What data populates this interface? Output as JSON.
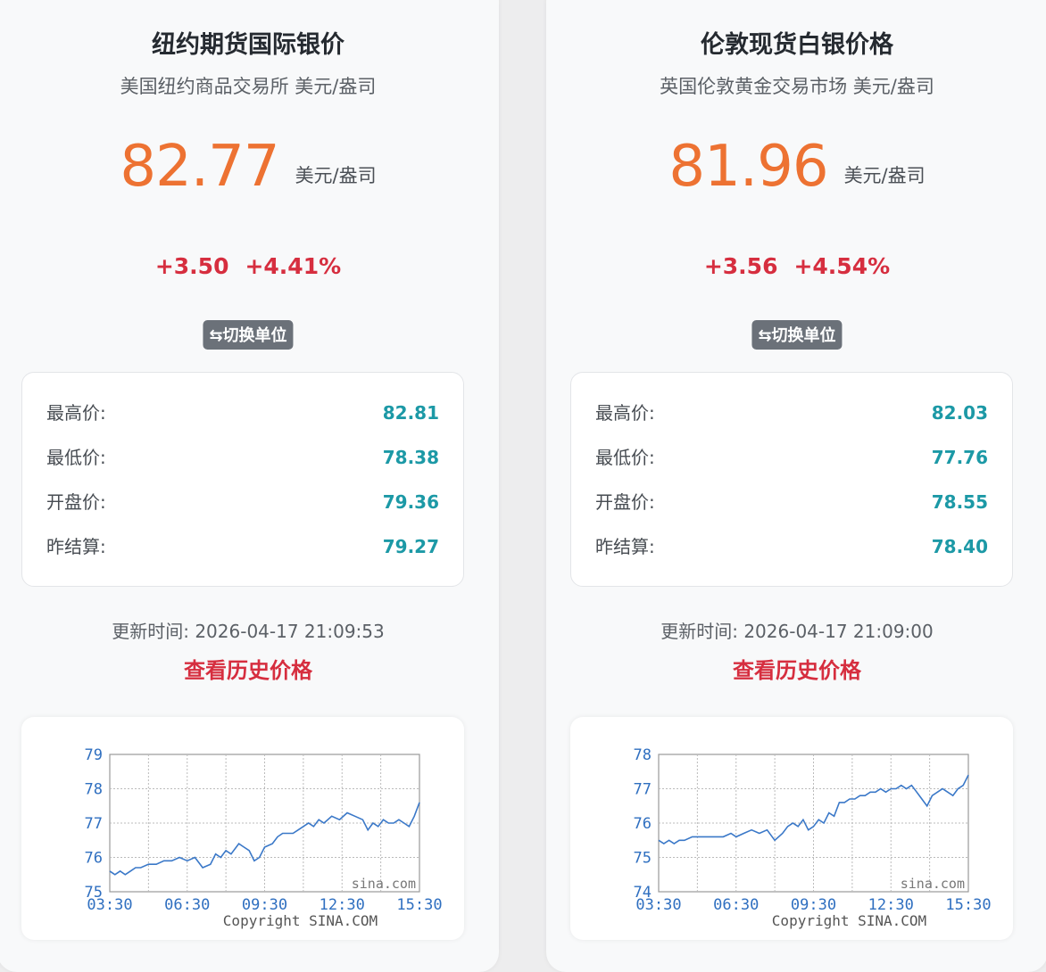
{
  "cards": [
    {
      "title": "纽约期货国际银价",
      "subtitle": "美国纽约商品交易所 美元/盎司",
      "price": "82.77",
      "price_unit": "美元/盎司",
      "change": "+3.50",
      "change_pct": "+4.41%",
      "switch_label": "⇆切换单位",
      "stats": [
        {
          "label": "最高价:",
          "value": "82.81"
        },
        {
          "label": "最低价:",
          "value": "78.38"
        },
        {
          "label": "开盘价:",
          "value": "79.36"
        },
        {
          "label": "昨结算:",
          "value": "79.27"
        }
      ],
      "updated": "更新时间: 2026-04-17 21:09:53",
      "history_link": "查看历史价格",
      "chart_data": {
        "type": "line",
        "x_ticks": [
          "03:30",
          "06:30",
          "09:30",
          "12:30",
          "15:30"
        ],
        "y_ticks": [
          "79",
          "78",
          "77",
          "76",
          "75"
        ],
        "ylim": [
          75,
          79
        ],
        "watermark": "sina.com",
        "copyright": "Copyright  SINA.COM",
        "grid": true,
        "x": [
          0,
          0.2,
          0.4,
          0.6,
          0.8,
          1.0,
          1.2,
          1.5,
          1.8,
          2.1,
          2.4,
          2.7,
          3.0,
          3.3,
          3.6,
          3.9,
          4.1,
          4.3,
          4.5,
          4.7,
          5.0,
          5.2,
          5.4,
          5.6,
          5.8,
          6.0,
          6.3,
          6.5,
          6.7,
          6.9,
          7.1,
          7.3,
          7.5,
          7.7,
          7.9,
          8.1,
          8.3,
          8.6,
          8.9,
          9.2,
          9.5,
          9.8,
          10.0,
          10.2,
          10.4,
          10.6,
          10.8,
          11.0,
          11.2,
          11.4,
          11.6,
          11.8,
          12.0
        ],
        "y": [
          75.6,
          75.5,
          75.6,
          75.5,
          75.6,
          75.7,
          75.7,
          75.8,
          75.8,
          75.9,
          75.9,
          76.0,
          75.9,
          76.0,
          75.7,
          75.8,
          76.1,
          76.0,
          76.2,
          76.1,
          76.4,
          76.3,
          76.2,
          75.9,
          76.0,
          76.3,
          76.4,
          76.6,
          76.7,
          76.7,
          76.7,
          76.8,
          76.9,
          77.0,
          76.9,
          77.1,
          77.0,
          77.2,
          77.1,
          77.3,
          77.2,
          77.1,
          76.8,
          77.0,
          76.9,
          77.1,
          77.0,
          77.0,
          77.1,
          77.0,
          76.9,
          77.2,
          77.6
        ]
      }
    },
    {
      "title": "伦敦现货白银价格",
      "subtitle": "英国伦敦黄金交易市场 美元/盎司",
      "price": "81.96",
      "price_unit": "美元/盎司",
      "change": "+3.56",
      "change_pct": "+4.54%",
      "switch_label": "⇆切换单位",
      "stats": [
        {
          "label": "最高价:",
          "value": "82.03"
        },
        {
          "label": "最低价:",
          "value": "77.76"
        },
        {
          "label": "开盘价:",
          "value": "78.55"
        },
        {
          "label": "昨结算:",
          "value": "78.40"
        }
      ],
      "updated": "更新时间: 2026-04-17 21:09:00",
      "history_link": "查看历史价格",
      "chart_data": {
        "type": "line",
        "x_ticks": [
          "03:30",
          "06:30",
          "09:30",
          "12:30",
          "15:30"
        ],
        "y_ticks": [
          "78",
          "77",
          "76",
          "75",
          "74"
        ],
        "ylim": [
          74,
          78
        ],
        "watermark": "sina.com",
        "copyright": "Copyright  SINA.COM",
        "grid": true,
        "x": [
          0,
          0.2,
          0.4,
          0.6,
          0.8,
          1.0,
          1.3,
          1.6,
          1.9,
          2.2,
          2.5,
          2.8,
          3.0,
          3.3,
          3.6,
          3.9,
          4.2,
          4.5,
          4.8,
          5.0,
          5.2,
          5.4,
          5.6,
          5.8,
          6.0,
          6.2,
          6.4,
          6.6,
          6.8,
          7.0,
          7.2,
          7.4,
          7.6,
          7.8,
          8.0,
          8.2,
          8.4,
          8.6,
          8.8,
          9.0,
          9.2,
          9.4,
          9.6,
          9.8,
          10.0,
          10.2,
          10.4,
          10.6,
          10.8,
          11.0,
          11.2,
          11.4,
          11.6,
          11.8,
          12.0
        ],
        "y": [
          75.5,
          75.4,
          75.5,
          75.4,
          75.5,
          75.5,
          75.6,
          75.6,
          75.6,
          75.6,
          75.6,
          75.7,
          75.6,
          75.7,
          75.8,
          75.7,
          75.8,
          75.5,
          75.7,
          75.9,
          76.0,
          75.9,
          76.1,
          75.8,
          75.9,
          76.1,
          76.0,
          76.3,
          76.2,
          76.6,
          76.6,
          76.7,
          76.7,
          76.8,
          76.8,
          76.9,
          76.9,
          77.0,
          76.9,
          77.0,
          77.0,
          77.1,
          77.0,
          77.1,
          76.9,
          76.7,
          76.5,
          76.8,
          76.9,
          77.0,
          76.9,
          76.8,
          77.0,
          77.1,
          77.4
        ]
      }
    }
  ]
}
